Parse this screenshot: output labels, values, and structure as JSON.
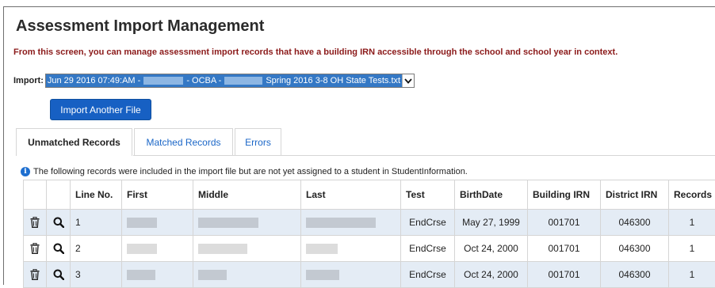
{
  "page": {
    "title": "Assessment Import Management",
    "subtitle": "From this screen, you can manage assessment import records that have a building IRN accessible through the school and school year in context."
  },
  "import": {
    "label": "Import:",
    "selected_part1": "Jun 29 2016 07:49:AM -",
    "selected_part2": "- OCBA -",
    "selected_part3": "Spring 2016 3-8 OH State Tests.txt"
  },
  "buttons": {
    "import_another": "Import Another File"
  },
  "tabs": [
    {
      "label": "Unmatched Records"
    },
    {
      "label": "Matched Records"
    },
    {
      "label": "Errors"
    }
  ],
  "info_text": "The following records were included in the import file but are not yet assigned to a student in StudentInformation.",
  "table": {
    "columns": [
      "",
      "",
      "Line No.",
      "First",
      "Middle",
      "Last",
      "Test",
      "BirthDate",
      "Building IRN",
      "District IRN",
      "Records"
    ],
    "rows": [
      {
        "line": "1",
        "test": "EndCrse",
        "birthdate": "May 27, 1999",
        "building_irn": "001701",
        "district_irn": "046300",
        "records": "1"
      },
      {
        "line": "2",
        "test": "EndCrse",
        "birthdate": "Oct 24, 2000",
        "building_irn": "001701",
        "district_irn": "046300",
        "records": "1"
      },
      {
        "line": "3",
        "test": "EndCrse",
        "birthdate": "Oct 24, 2000",
        "building_irn": "001701",
        "district_irn": "046300",
        "records": "1"
      }
    ]
  },
  "icons": {
    "delete": "trash-icon",
    "view": "search-icon",
    "info": "info-icon",
    "dropdown": "chevron-down-icon"
  },
  "colors": {
    "primary_button": "#1760c3",
    "subtitle": "#8b1a1a",
    "tab_link": "#1a66c7",
    "row_stripe": "#e4ecf5"
  }
}
